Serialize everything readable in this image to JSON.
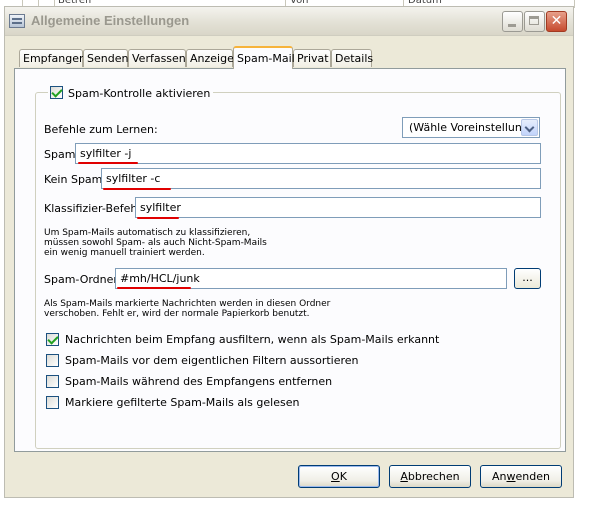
{
  "background_table": {
    "columns": [
      "Betreff",
      "Von",
      "Datum"
    ]
  },
  "window": {
    "title": "Allgemeine Einstellungen"
  },
  "tabs": [
    {
      "label": "Empfangen",
      "active": false
    },
    {
      "label": "Senden",
      "active": false
    },
    {
      "label": "Verfassen",
      "active": false
    },
    {
      "label": "Anzeige",
      "active": false
    },
    {
      "label": "Spam-Mail",
      "active": true
    },
    {
      "label": "Privat",
      "active": false
    },
    {
      "label": "Details",
      "active": false
    }
  ],
  "spam": {
    "enable_label": "Spam-Kontrolle aktivieren",
    "enable_checked": true,
    "learn_label": "Befehle zum Lernen:",
    "preset_value": "(Wähle Voreinstellung)",
    "spam_label": "Spam",
    "spam_value": "sylfilter -j",
    "nospam_label": "Kein Spam",
    "nospam_value": "sylfilter -c",
    "classify_label": "Klassifizier-Befehl",
    "classify_value": "sylfilter",
    "hint1_line1": "Um Spam-Mails automatisch zu klassifizieren,",
    "hint1_line2": "müssen sowohl Spam- als auch Nicht-Spam-Mails",
    "hint1_line3": "ein wenig manuell trainiert werden.",
    "folder_label": "Spam-Ordner",
    "folder_value": "#mh/HCL/junk",
    "browse_label": "...",
    "hint2_line1": "Als Spam-Mails markierte Nachrichten werden in diesen Ordner",
    "hint2_line2": "verschoben. Fehlt er, wird der normale Papierkorb benutzt.",
    "options": [
      {
        "label": "Nachrichten beim Empfang ausfiltern, wenn als Spam-Mails erkannt",
        "checked": true
      },
      {
        "label": "Spam-Mails vor dem eigentlichen Filtern aussortieren",
        "checked": false
      },
      {
        "label": "Spam-Mails während des Empfangens entfernen",
        "checked": false
      },
      {
        "label": "Markiere gefilterte Spam-Mails als gelesen",
        "checked": false
      }
    ]
  },
  "buttons": {
    "ok_mnemonic": "O",
    "ok_rest": "K",
    "cancel_mnemonic": "A",
    "cancel_rest": "bbrechen",
    "apply_pre": "An",
    "apply_mnemonic": "w",
    "apply_post": "enden"
  },
  "colors": {
    "dialog_bg": "#ece9d8",
    "page_bg": "#fcfcfe",
    "field_border": "#7f9db9",
    "annotation_underline": "#e00000",
    "active_tab_highlight": "#f6b33b",
    "checkmark": "#21a121"
  }
}
